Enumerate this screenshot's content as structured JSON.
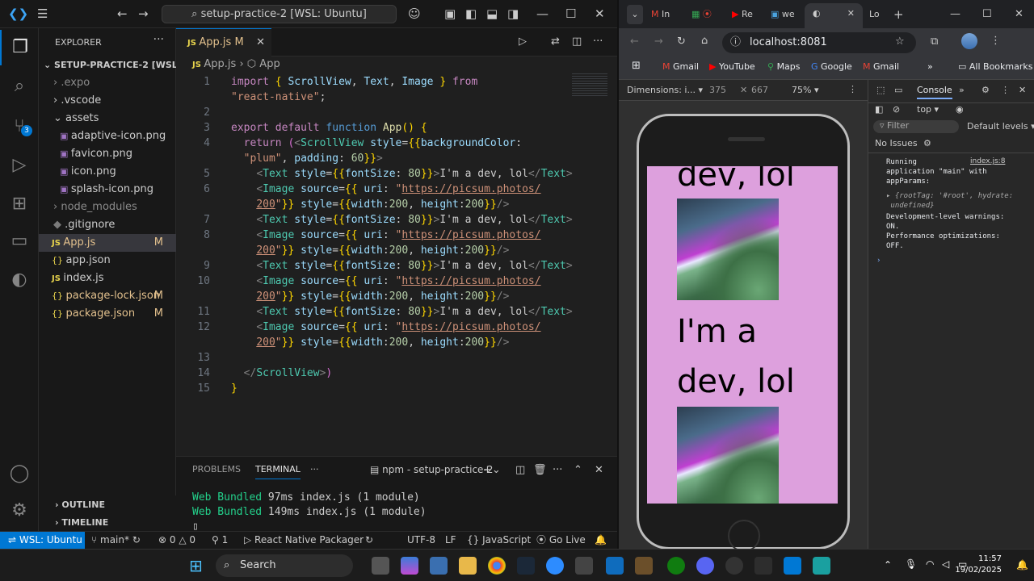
{
  "vscode": {
    "title": "setup-practice-2 [WSL: Ubuntu]",
    "explorer": {
      "header": "EXPLORER",
      "root": "SETUP-PRACTICE-2 [WSL: ...",
      "items": [
        {
          "label": ".expo",
          "type": "folder"
        },
        {
          "label": ".vscode",
          "type": "folder"
        },
        {
          "label": "assets",
          "type": "folder-open"
        },
        {
          "label": "adaptive-icon.png",
          "type": "image"
        },
        {
          "label": "favicon.png",
          "type": "image"
        },
        {
          "label": "icon.png",
          "type": "image"
        },
        {
          "label": "splash-icon.png",
          "type": "image"
        },
        {
          "label": "node_modules",
          "type": "folder"
        },
        {
          "label": ".gitignore",
          "type": "git"
        },
        {
          "label": "App.js",
          "type": "js",
          "mod": "M"
        },
        {
          "label": "app.json",
          "type": "json"
        },
        {
          "label": "index.js",
          "type": "js"
        },
        {
          "label": "package-lock.json",
          "type": "json",
          "mod": "M"
        },
        {
          "label": "package.json",
          "type": "json",
          "mod": "M"
        }
      ],
      "outline": "OUTLINE",
      "timeline": "TIMELINE"
    },
    "tab": {
      "name": "App.js",
      "mod": "M"
    },
    "breadcrumb": {
      "file": "App.js",
      "symbol": "App"
    },
    "panel": {
      "problems": "PROBLEMS",
      "terminal": "TERMINAL",
      "task": "npm - setup-practice-2",
      "lines": [
        {
          "k": "Web Bundled",
          "v": " 97ms index.js (1 module)"
        },
        {
          "k": "Web Bundled",
          "v": " 149ms index.js (1 module)"
        }
      ]
    },
    "status": {
      "remote": "WSL: Ubuntu",
      "branch": "main*",
      "errors": "0",
      "warnings": "0",
      "ports": "1",
      "packager": "React Native Packager",
      "encoding": "UTF-8",
      "eol": "LF",
      "lang": "JavaScript",
      "golive": "Go Live"
    }
  },
  "chrome": {
    "tabs": [
      "In",
      "Re",
      "we",
      "Lo"
    ],
    "url": "localhost:8081",
    "bookmarks": [
      "Gmail",
      "YouTube",
      "Maps",
      "Google",
      "Gmail"
    ],
    "all_bookmarks": "All Bookmarks",
    "device": {
      "label": "Dimensions: i...",
      "width": "375",
      "height": "667",
      "zoom": "75%"
    },
    "app_text": [
      "dev, lol",
      "I'm a",
      "dev, lol"
    ],
    "devtools": {
      "tab": "Console",
      "context": "top",
      "filter": "Filter",
      "levels": "Default levels",
      "issues": "No Issues",
      "source": "index.js:8",
      "log": "Running\napplication \"main\" with\nappParams:",
      "obj": "{rootTag: '#root', hydrate:\n undefined}",
      "log2": "Development-level warnings:\nON.\nPerformance optimizations:\nOFF."
    }
  },
  "taskbar": {
    "search": "Search",
    "time": "11:57",
    "date": "19/02/2025"
  }
}
